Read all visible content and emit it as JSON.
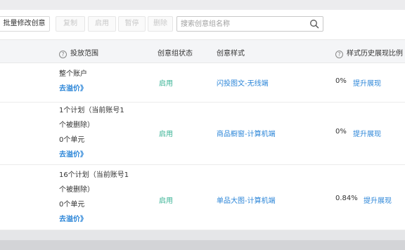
{
  "toolbar": {
    "batch_edit_label": "批量修改创意",
    "copy_label": "复制",
    "enable_label": "启用",
    "pause_label": "暂停",
    "delete_label": "删除",
    "search_placeholder": "搜索创意组名称"
  },
  "table": {
    "headers": {
      "scope": "投放范围",
      "status": "创意组状态",
      "style": "创意样式",
      "history": "样式历史展现比例"
    },
    "rows": [
      {
        "scope_lines": [
          "整个账户"
        ],
        "bid_link": "去溢价》",
        "status": "启用",
        "style": "闪投图文-无线端",
        "ratio": "0%",
        "improve": "提升展现"
      },
      {
        "scope_lines": [
          "1个计划（当前账号1",
          "个被删除）",
          "0个单元"
        ],
        "bid_link": "去溢价》",
        "status": "启用",
        "style": "商品橱窗-计算机端",
        "ratio": "0%",
        "improve": "提升展现"
      },
      {
        "scope_lines": [
          "16个计划（当前账号1",
          "个被删除）",
          "0个单元"
        ],
        "bid_link": "去溢价》",
        "status": "启用",
        "style": "单品大图-计算机端",
        "ratio": "0.84%",
        "improve": "提升展现"
      }
    ]
  }
}
